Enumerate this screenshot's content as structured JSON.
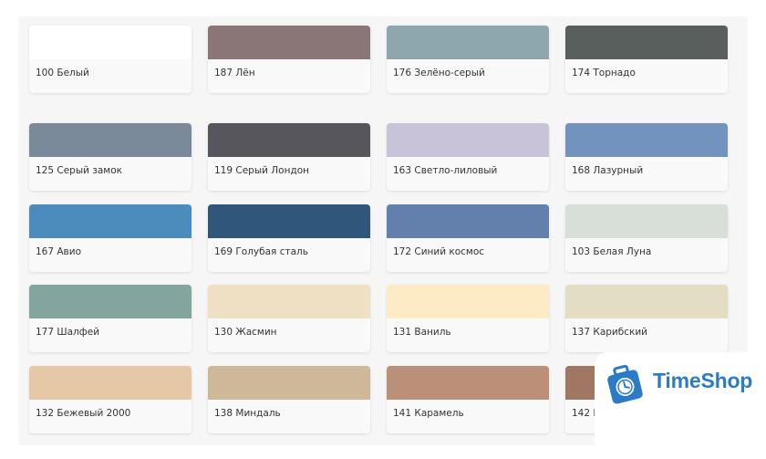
{
  "colors": {
    "panel_background": "#f6f6f6",
    "card_background": "#f9f9f9",
    "label_text": "#333333",
    "brand_blue": "#2b7bc9"
  },
  "swatches": [
    {
      "label": "100 Белый",
      "color": "#ffffff"
    },
    {
      "label": "187 Лён",
      "color": "#8a7677"
    },
    {
      "label": "176 Зелёно-серый",
      "color": "#8ea7af"
    },
    {
      "label": "174 Торнадо",
      "color": "#585f5c"
    },
    {
      "label": "125 Серый замок",
      "color": "#7a8a9b"
    },
    {
      "label": "119 Серый Лондон",
      "color": "#58565d"
    },
    {
      "label": "163 Светло-лиловый",
      "color": "#c8c3d8"
    },
    {
      "label": "168 Лазурный",
      "color": "#7293be"
    },
    {
      "label": "167 Авио",
      "color": "#4b8cbc"
    },
    {
      "label": "169 Голубая сталь",
      "color": "#305779"
    },
    {
      "label": "172 Синий космос",
      "color": "#637fab"
    },
    {
      "label": "103 Белая Луна",
      "color": "#d8dfd8"
    },
    {
      "label": "177 Шалфей",
      "color": "#84a4a0"
    },
    {
      "label": "130 Жасмин",
      "color": "#efdfc3"
    },
    {
      "label": "131 Ваниль",
      "color": "#fdebc6"
    },
    {
      "label": "137 Карибский",
      "color": "#e2ddc3"
    },
    {
      "label": "132 Бежевый 2000",
      "color": "#e5c9a6"
    },
    {
      "label": "138 Миндаль",
      "color": "#cdb99a"
    },
    {
      "label": "141 Карамель",
      "color": "#bb9079"
    },
    {
      "label": "142 К",
      "color": "#9f7763"
    }
  ],
  "watermark": {
    "brand_name": "TimeShop",
    "icon": "suitcase-clock-icon"
  }
}
